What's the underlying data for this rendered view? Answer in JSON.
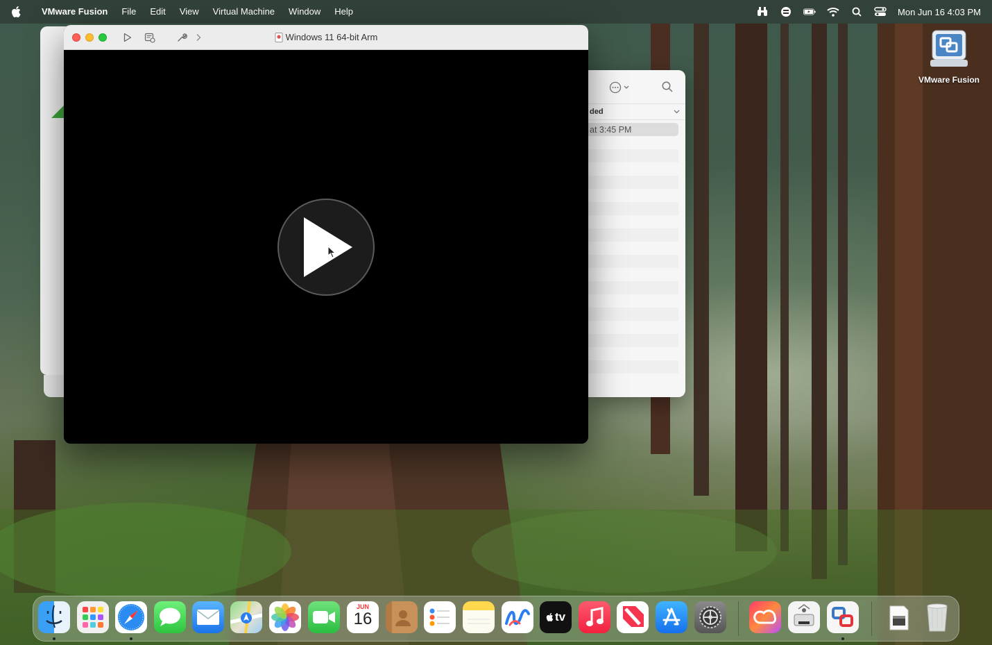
{
  "menubar": {
    "app_name": "VMware Fusion",
    "items": [
      "File",
      "Edit",
      "View",
      "Virtual Machine",
      "Window",
      "Help"
    ],
    "clock": "Mon Jun 16  4:03 PM"
  },
  "vm_window": {
    "title": "Windows 11 64-bit Arm"
  },
  "side_window": {
    "header": "ded",
    "selected_row": "at 3:45 PM"
  },
  "desktop": {
    "icon_label": "VMware Fusion"
  },
  "dock": {
    "calendar_month": "JUN",
    "calendar_day": "16",
    "tv_label": "tv"
  },
  "colors": {
    "close": "#ff5f57",
    "minimize": "#febc2e",
    "zoom": "#28c840"
  }
}
